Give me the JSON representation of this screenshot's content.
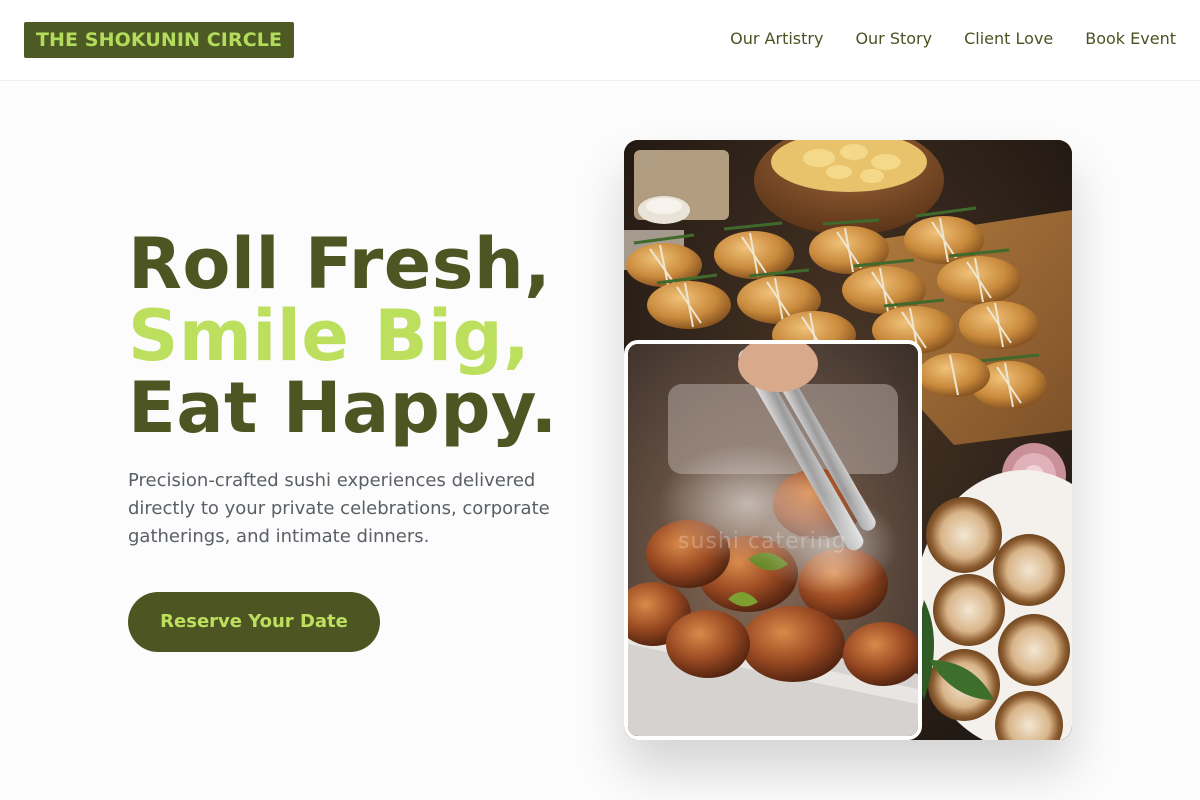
{
  "brand": {
    "logo_text": "THE SHOKUNIN CIRCLE",
    "logo_bg": "#4d5a23",
    "logo_fg": "#b4dc5c"
  },
  "nav": {
    "items": [
      {
        "label": "Our Artistry"
      },
      {
        "label": "Our Story"
      },
      {
        "label": "Client Love"
      },
      {
        "label": "Book Event"
      }
    ]
  },
  "hero": {
    "line1": "Roll Fresh,",
    "line2": "Smile Big,",
    "line3": "Eat Happy.",
    "description": "Precision-crafted sushi experiences delivered directly to your private celebrations, corporate gatherings, and intimate dinners.",
    "cta_label": "Reserve Your Date",
    "accent_color": "#bce05e",
    "primary_color": "#4d5622"
  },
  "images": {
    "main_icon": "food-platter-photo",
    "inset_icon": "grilled-skewers-photo",
    "watermark": "sushi catering"
  }
}
